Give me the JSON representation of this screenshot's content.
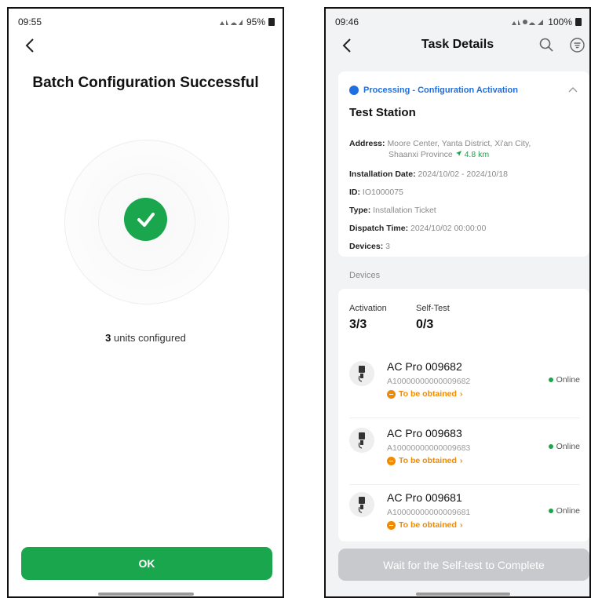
{
  "left": {
    "status_time": "09:55",
    "battery": "95%",
    "title": "Batch Configuration Successful",
    "units_count": "3",
    "units_text": " units configured",
    "ok_label": "OK"
  },
  "right": {
    "status_time": "09:46",
    "battery": "100%",
    "title": "Task Details",
    "task_status": "Processing - Configuration Activation",
    "station_name": "Test Station",
    "address_label": "Address:",
    "address_line1": "Moore Center, Yanta District, Xi'an City,",
    "address_line2": "Shaanxi Province",
    "distance": "4.8 km",
    "install_label": "Installation Date:",
    "install_value": "2024/10/02 - 2024/10/18",
    "id_label": "ID:",
    "id_value": "IO1000075",
    "type_label": "Type:",
    "type_value": "Installation Ticket",
    "dispatch_label": "Dispatch Time:",
    "dispatch_value": "2024/10/02 00:00:00",
    "devices_label": "Devices:",
    "devices_value": "3",
    "devices_section": "Devices",
    "activation_label": "Activation",
    "activation_value": "3/3",
    "selftest_label": "Self-Test",
    "selftest_value": "0/3",
    "devices": [
      {
        "name": "AC Pro 009682",
        "sn": "A10000000000009682",
        "state": "To be obtained",
        "online": "Online"
      },
      {
        "name": "AC Pro 009683",
        "sn": "A10000000000009683",
        "state": "To be obtained",
        "online": "Online"
      },
      {
        "name": "AC Pro 009681",
        "sn": "A10000000000009681",
        "state": "To be obtained",
        "online": "Online"
      }
    ],
    "wait_label": "Wait for the Self-test to Complete"
  },
  "icons": {
    "back": "chevron-left-icon",
    "success": "check-icon",
    "search": "search-icon",
    "filter": "filter-icon",
    "collapse": "chevron-up-icon",
    "device": "charger-icon",
    "navigate": "navigation-arrow-icon"
  },
  "colors": {
    "success_green": "#1aa64c",
    "processing_blue": "#1f6fe0",
    "warning_orange": "#f08a00",
    "disabled_button": "#c8c9cc"
  }
}
